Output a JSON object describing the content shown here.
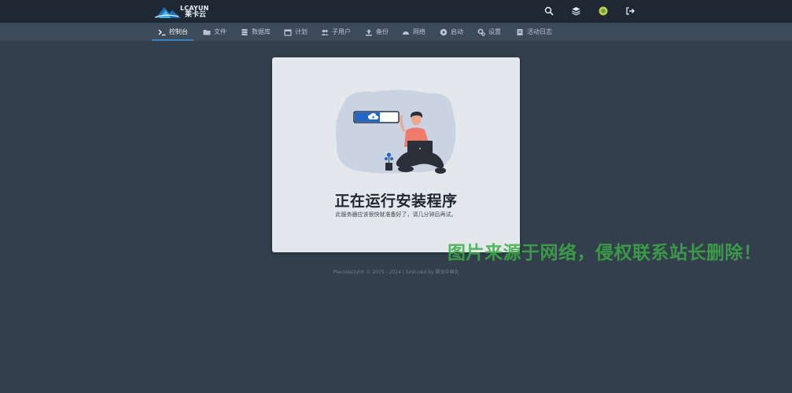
{
  "header": {
    "brand_text": "LCAYUN",
    "brand_cn": "莱卡云"
  },
  "top_actions": [
    {
      "icon": "search-icon"
    },
    {
      "icon": "layers-icon"
    },
    {
      "icon": "avatar"
    },
    {
      "icon": "sign-out-icon"
    }
  ],
  "nav": {
    "items": [
      {
        "label": "控制台",
        "icon": "terminal-icon",
        "active": true
      },
      {
        "label": "文件",
        "icon": "folder-icon"
      },
      {
        "label": "数据库",
        "icon": "database-icon"
      },
      {
        "label": "计划",
        "icon": "calendar-icon"
      },
      {
        "label": "子用户",
        "icon": "users-icon"
      },
      {
        "label": "备份",
        "icon": "upload-icon"
      },
      {
        "label": "网络",
        "icon": "network-icon"
      },
      {
        "label": "启动",
        "icon": "play-icon"
      },
      {
        "label": "设置",
        "icon": "cogs-icon"
      },
      {
        "label": "活动日志",
        "icon": "log-icon"
      }
    ]
  },
  "card": {
    "title": "正在运行安装程序",
    "subtitle": "此服务器应该很快就准备好了，请几分钟后再试。"
  },
  "footer": {
    "text": "Pterodactyl® © 2015 - 2024 | Sinicized by 翼龙中国化"
  },
  "watermark": "图片来源于网络，侵权联系站长删除！",
  "colors": {
    "topbar": "#1f2733",
    "navbar": "#3d4a5a",
    "background": "#333f4d",
    "accent": "#3b82c4",
    "card": "#e4e8ed"
  }
}
